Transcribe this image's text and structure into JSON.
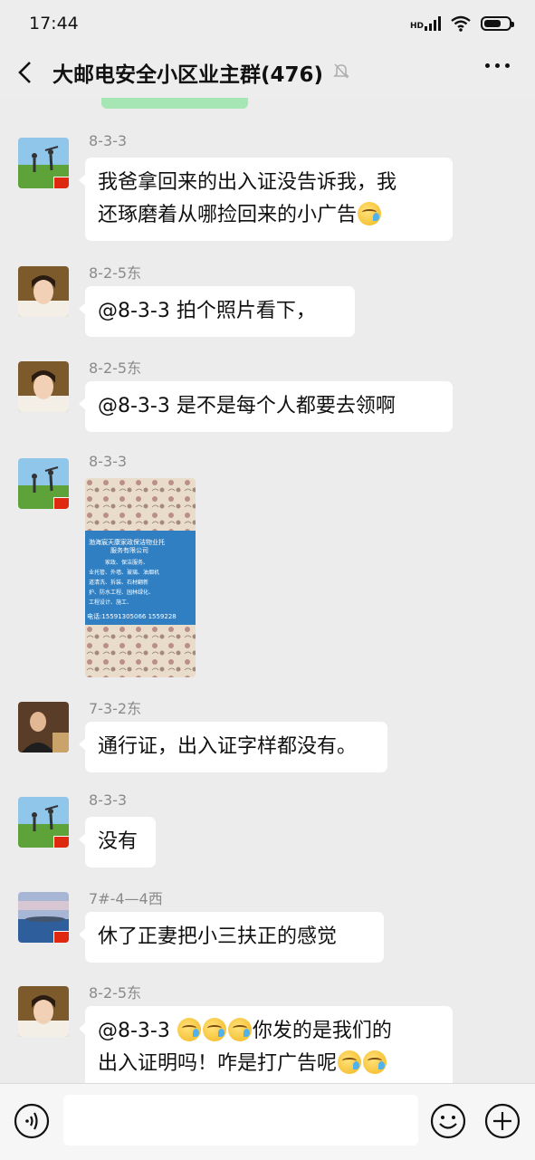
{
  "status_bar": {
    "time": "17:44",
    "network": "HD"
  },
  "header": {
    "title": "大邮电安全小区业主群(476)"
  },
  "messages": [
    {
      "sender": "8-3-3",
      "lines": [
        "我爸拿回来的出入证没告诉我，我",
        "还琢磨着从哪捡回来的小广告"
      ]
    },
    {
      "sender": "8-2-5东",
      "text": "@8-3-3  拍个照片看下，"
    },
    {
      "sender": "8-2-5东",
      "text": "@8-3-3  是不是每个人都要去领啊"
    },
    {
      "sender": "8-3-3",
      "photo": {
        "lines": [
          "渤海宸天康家政保洁物业托",
          "服务有限公司",
          "家政、保洁服务、",
          "业托管、外墙、玻璃、油烟机",
          "道清洗、拆装、石材翻新",
          "护、防水工程、园林绿化、",
          "工程设计、施工、",
          "电话:15591305066  1559228"
        ]
      }
    },
    {
      "sender": "7-3-2东",
      "text": "通行证，出入证字样都没有。"
    },
    {
      "sender": "8-3-3",
      "text": "没有"
    },
    {
      "sender": "7#-4—4西",
      "text": "休了正妻把小三扶正的感觉"
    },
    {
      "sender": "8-2-5东",
      "lines": [
        "@8-3-3",
        "你发的是我们的",
        "出入证明吗！咋是打广告呢"
      ]
    }
  ],
  "colors": {
    "background": "#ececec",
    "bubble": "#ffffff",
    "own_bubble": "#a6e5b4",
    "sender_text": "#8a8a8a"
  }
}
